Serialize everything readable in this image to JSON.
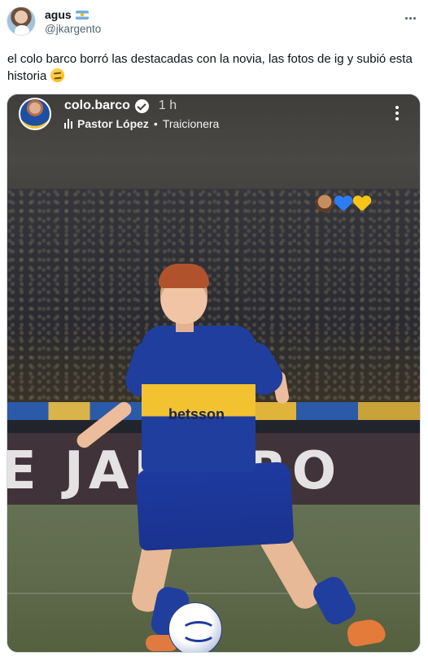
{
  "tweet": {
    "author": {
      "display_name": "agus",
      "handle": "@jkargento",
      "avatar_icon": "profile-photo",
      "badge_icon": "argentina-flag-icon"
    },
    "text": "el colo barco borró las destacadas con la novia, las fotos de ig y subió esta historia",
    "text_emoji_icon": "thinking-face-icon"
  },
  "story": {
    "username": "colo.barco",
    "verified": true,
    "time": "1 h",
    "music": {
      "artist": "Pastor López",
      "separator": "•",
      "song": "Traicionera"
    },
    "sticker_emojis": [
      "person-icon",
      "blue-heart-icon",
      "yellow-heart-icon"
    ],
    "photo": {
      "shirt_sponsor": "betsson",
      "banner_text": "E JANEIRO"
    }
  },
  "colors": {
    "text_primary": "#0f1419",
    "text_secondary": "#536471",
    "story_header_bg": "#403e3b",
    "kit_blue": "#1f3e9e",
    "kit_yellow": "#f2c230"
  }
}
